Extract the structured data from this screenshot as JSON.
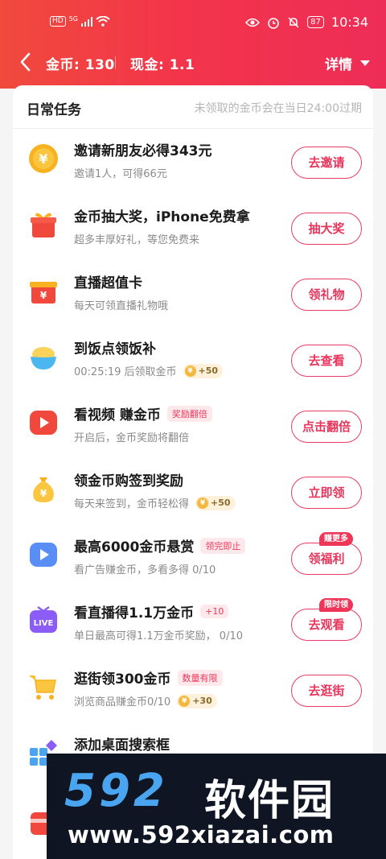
{
  "status": {
    "network": "5G",
    "hd": "HD",
    "battery": "87",
    "time": "10:34"
  },
  "header": {
    "coins": "金币: 130",
    "cash": "现金: 1.1",
    "detail": "详情"
  },
  "section": {
    "title": "日常任务",
    "note": "未领取的金币会在当日24:00过期"
  },
  "tasks": [
    {
      "title": "邀请新朋友必得343元",
      "subtitle": "邀请1人，可得66元",
      "button": "去邀请"
    },
    {
      "title": "金币抽大奖，iPhone免费拿",
      "subtitle": "超多丰厚好礼，等您免费来",
      "button": "抽大奖"
    },
    {
      "title": "直播超值卡",
      "subtitle": "每天可领直播礼物哦",
      "button": "领礼物"
    },
    {
      "title": "到饭点领饭补",
      "subtitle": "00:25:19 后领取金币",
      "reward": "+50",
      "button": "去查看"
    },
    {
      "title": "看视频 赚金币",
      "tag": "奖励翻倍",
      "subtitle": "开启后，金币奖励将翻倍",
      "button": "点击翻倍"
    },
    {
      "title": "领金币购签到奖励",
      "subtitle": "每天来签到，金币轻松得",
      "reward": "+50",
      "button": "立即领"
    },
    {
      "title": "最高6000金币悬赏",
      "tag": "领完即止",
      "subtitle": "看广告赚金币，多看多得 0/10",
      "button": "领福利",
      "badge": "赚更多"
    },
    {
      "title": "看直播得1.1万金币",
      "tag": "+10",
      "subtitle": "单日最高可得1.1万金币奖励，   0/10",
      "button": "去观看",
      "badge": "限时领"
    },
    {
      "title": "逛街领300金币",
      "tag": "数量有限",
      "subtitle": "浏览商品赚金币0/10",
      "reward": "+30",
      "button": "去逛街"
    },
    {
      "title": "添加桌面搜索框"
    }
  ],
  "icon_texts": {
    "coin": "¥",
    "live": "LIVE"
  },
  "watermark": {
    "logo": "592",
    "logo_cn": "软件园",
    "url": "www.592xiazai.com"
  }
}
